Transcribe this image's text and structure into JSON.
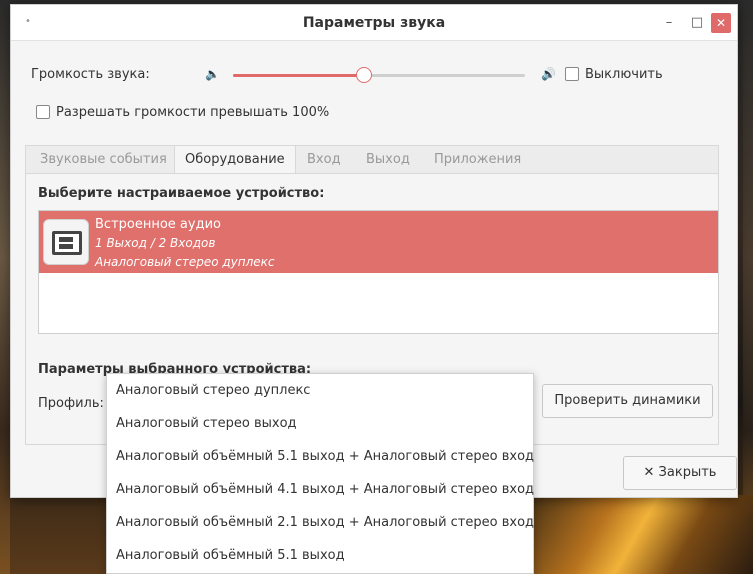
{
  "window": {
    "title": "Параметры звука",
    "close_glyph": "✕",
    "min_glyph": "–",
    "max_glyph": "□"
  },
  "volume": {
    "label": "Громкость звука:",
    "level_percent": 45,
    "mute_label": "Выключить",
    "over100_label": "Разрешать громкости превышать 100%"
  },
  "tabs": [
    {
      "label": "Звуковые события"
    },
    {
      "label": "Оборудование"
    },
    {
      "label": "Вход"
    },
    {
      "label": "Выход"
    },
    {
      "label": "Приложения"
    }
  ],
  "hardware": {
    "choose_heading": "Выберите настраиваемое устройство:",
    "device": {
      "name": "Встроенное аудио",
      "io": "1 Выход / 2 Входов",
      "profile": "Аналоговый стерео дуплекс"
    },
    "params_heading": "Параметры выбранного устройства:",
    "profile_label": "Профиль:",
    "test_button": "Проверить динамики"
  },
  "footer": {
    "close_button": "✕ Закрыть"
  },
  "profile_dropdown": {
    "options": [
      "Аналоговый стерео дуплекс",
      "Аналоговый стерео выход",
      "Аналоговый объёмный 5.1 выход + Аналоговый стерео вход",
      "Аналоговый объёмный 4.1 выход + Аналоговый стерео вход",
      "Аналоговый объёмный 2.1 выход + Аналоговый стерео вход",
      "Аналоговый объёмный 5.1 выход"
    ]
  },
  "colors": {
    "accent": "#e06a6a",
    "selected_row": "#e0706c"
  },
  "icons": {
    "speaker_low": "🔈",
    "speaker_high": "🔊"
  }
}
